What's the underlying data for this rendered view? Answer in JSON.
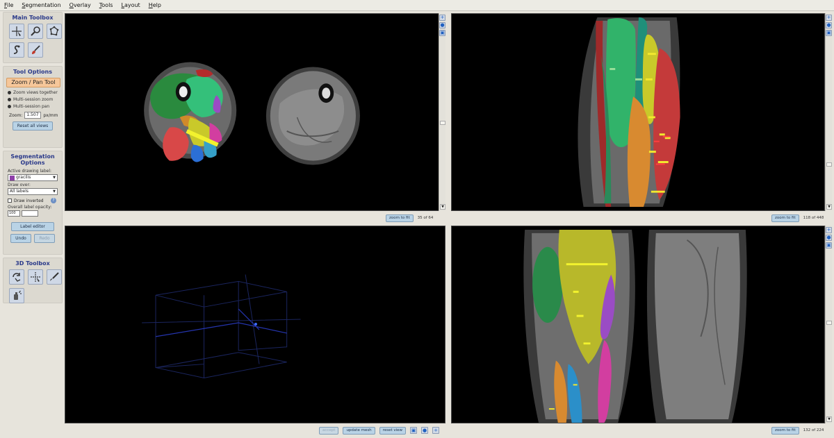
{
  "menu": [
    "File",
    "Segmentation",
    "Overlay",
    "Tools",
    "Layout",
    "Help"
  ],
  "main_toolbox": {
    "title": "Main Toolbox",
    "tools": [
      "crosshairs-icon",
      "zoom-icon",
      "polygon-icon",
      "snake-icon",
      "paintbrush-icon"
    ]
  },
  "tool_options": {
    "title": "Tool Options",
    "active_tool": "Zoom / Pan Tool",
    "options": [
      "Zoom views together",
      "Multi-session zoom",
      "Multi-session pan"
    ],
    "zoom_label": "Zoom:",
    "zoom_value": "1.507",
    "zoom_unit": "px/mm",
    "reset_label": "Reset all views"
  },
  "segmentation_options": {
    "title": "Segmentation Options",
    "active_label_caption": "Active drawing label:",
    "active_label_value": "gracilis",
    "active_label_color": "#8e3fa9",
    "draw_over_caption": "Draw over:",
    "draw_over_value": "All labels",
    "draw_inverted_label": "Draw inverted",
    "help_glyph": "?",
    "opacity_caption": "Overall label opacity:",
    "opacity_value": "100",
    "label_editor": "Label editor",
    "undo": "Undo",
    "redo": "Redo"
  },
  "toolbox_3d": {
    "title": "3D Toolbox",
    "tools": [
      "rotate-3d-icon",
      "crosshairs-3d-icon",
      "scalpel-icon",
      "spray-icon"
    ]
  },
  "views": {
    "axial": {
      "zoom_to_fit": "zoom to fit",
      "slice": "35 of 64"
    },
    "sagittal": {
      "zoom_to_fit": "zoom to fit",
      "slice": "118 of 448"
    },
    "coronal": {
      "zoom_to_fit": "zoom to fit",
      "slice": "132 of 224"
    },
    "view3d": {
      "accept": "accept",
      "update_mesh": "update mesh",
      "reset_view": "reset view"
    }
  },
  "icon_glyphs": {
    "plus": "+",
    "arrow_down": "▼"
  },
  "colors": {
    "background": "#e7e4dc",
    "section_title": "#2b3a8a",
    "active_tool": "#f6c79a",
    "button": "#b9d3e6"
  }
}
